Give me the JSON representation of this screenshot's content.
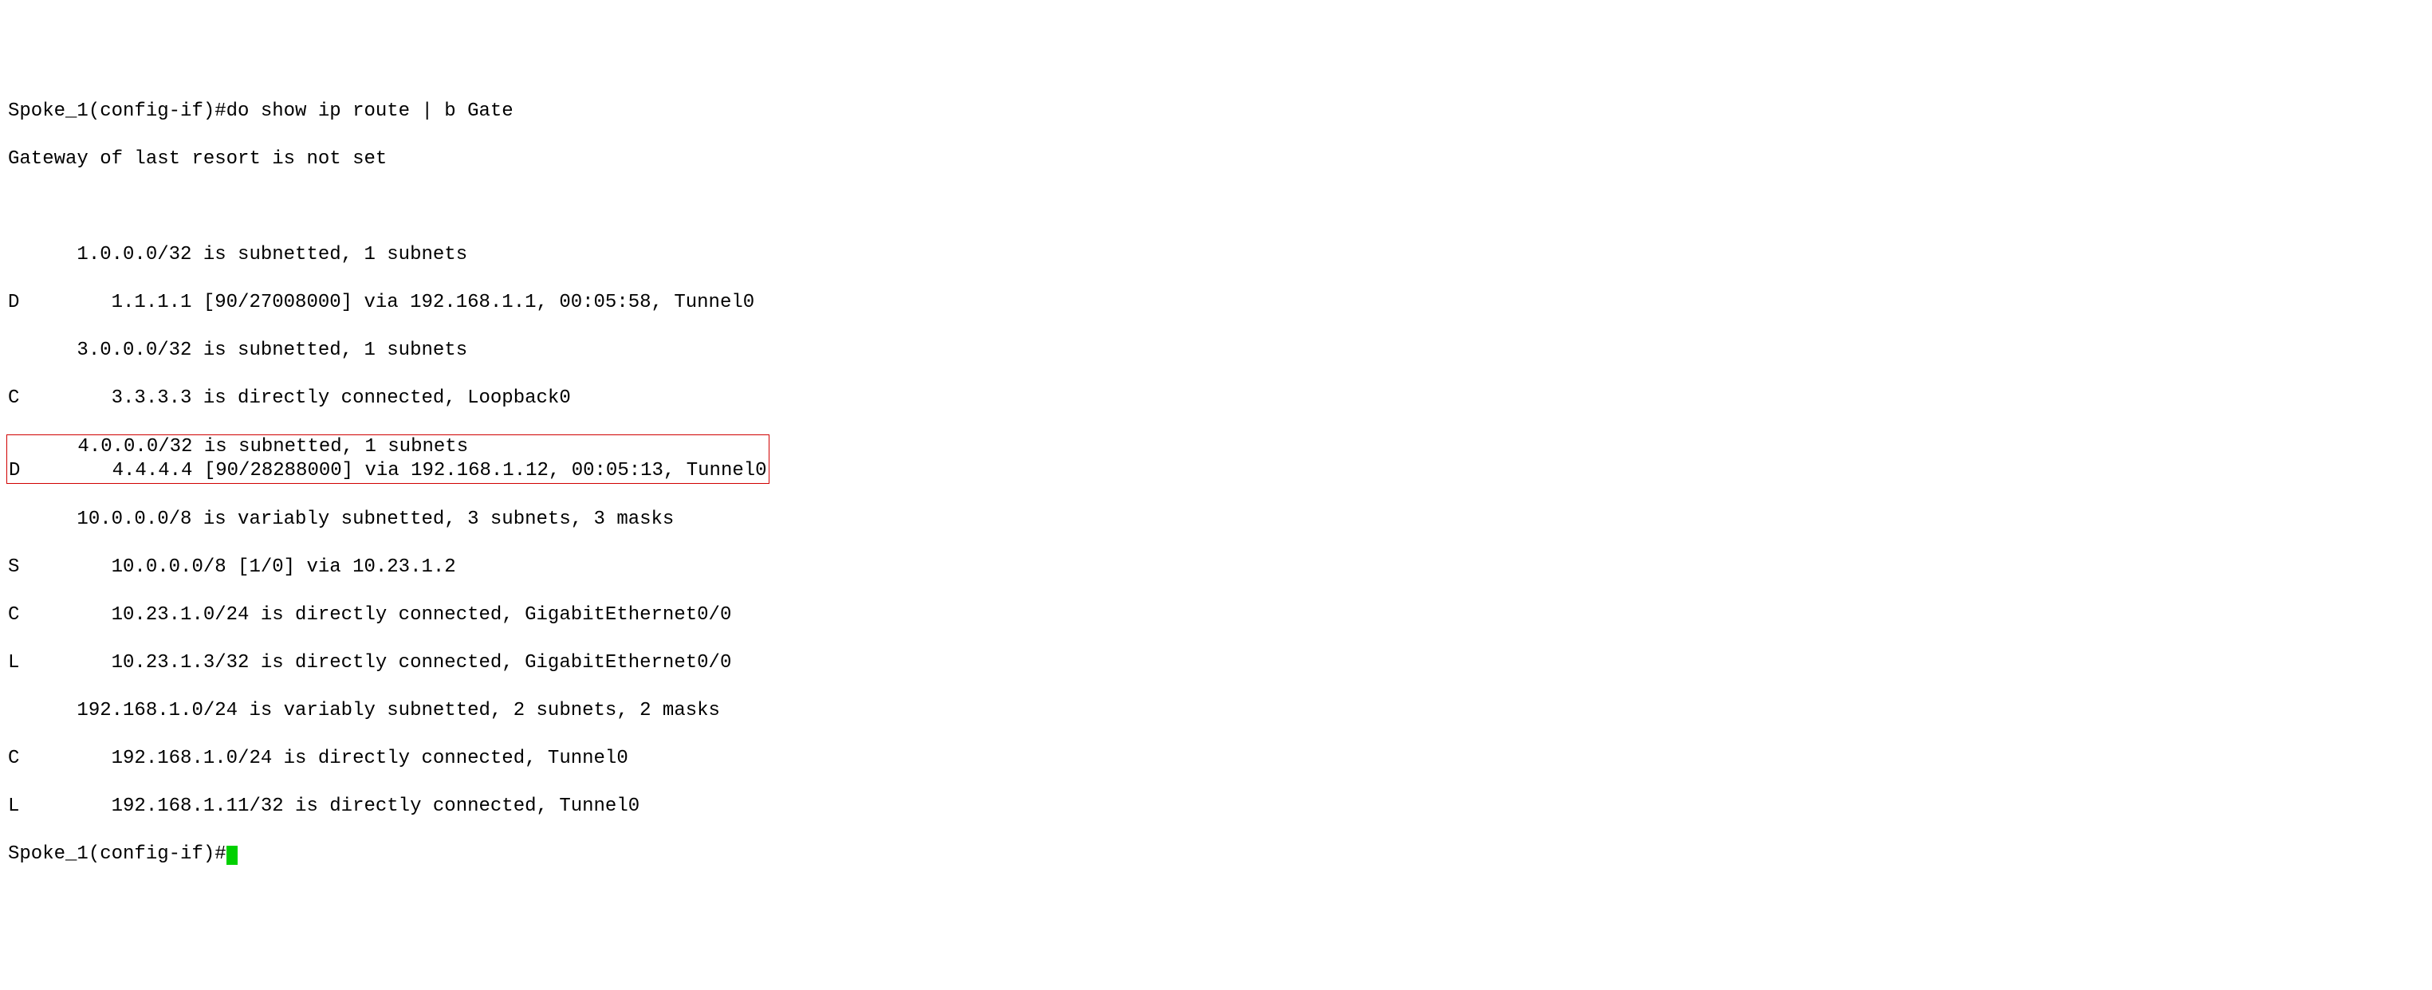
{
  "terminal": {
    "line1": "Spoke_1(config-if)#do show ip route | b Gate",
    "line2": "Gateway of last resort is not set",
    "line3": "",
    "line4": "      1.0.0.0/32 is subnetted, 1 subnets",
    "line5": "D        1.1.1.1 [90/27008000] via 192.168.1.1, 00:05:58, Tunnel0",
    "line6": "      3.0.0.0/32 is subnetted, 1 subnets",
    "line7": "C        3.3.3.3 is directly connected, Loopback0",
    "line8": "      4.0.0.0/32 is subnetted, 1 subnets                        ",
    "line9": "D        4.4.4.4 [90/28288000] via 192.168.1.12, 00:05:13, Tunnel0",
    "line10": "      10.0.0.0/8 is variably subnetted, 3 subnets, 3 masks",
    "line11": "S        10.0.0.0/8 [1/0] via 10.23.1.2",
    "line12": "C        10.23.1.0/24 is directly connected, GigabitEthernet0/0",
    "line13": "L        10.23.1.3/32 is directly connected, GigabitEthernet0/0",
    "line14": "      192.168.1.0/24 is variably subnetted, 2 subnets, 2 masks",
    "line15": "C        192.168.1.0/24 is directly connected, Tunnel0",
    "line16": "L        192.168.1.11/32 is directly connected, Tunnel0",
    "prompt": "Spoke_1(config-if)#"
  }
}
